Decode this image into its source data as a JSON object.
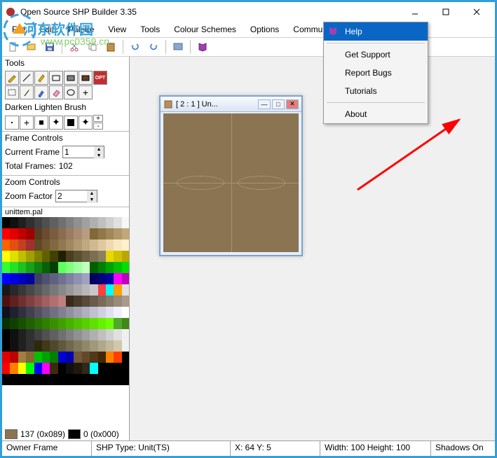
{
  "window": {
    "title": "Open Source SHP Builder 3.35"
  },
  "menubar": [
    "File",
    "Edit",
    "Palette",
    "View",
    "Tools",
    "Colour Schemes",
    "Options",
    "Community",
    "Help"
  ],
  "helpmenu": {
    "help": "Help",
    "support": "Get Support",
    "bugs": "Report Bugs",
    "tutorials": "Tutorials",
    "about": "About"
  },
  "sidebar": {
    "tools_label": "Tools",
    "dlb_label": "Darken Lighten Brush",
    "fc_label": "Frame Controls",
    "current_frame_label": "Current Frame",
    "current_frame_value": "1",
    "total_frames_label": "Total Frames:",
    "total_frames_value": "102",
    "zoom_label": "Zoom Controls",
    "zoom_factor_label": "Zoom Factor",
    "zoom_factor_value": "2",
    "palette_name": "unittem.pal",
    "swatch1_val": "137 (0x089)",
    "swatch2_val": "0 (0x000)"
  },
  "innerwin": {
    "title": "[ 2 : 1 ] Un..."
  },
  "status": {
    "s1": "Owner Frame",
    "s2": "SHP Type: Unit(TS)",
    "s3": "X: 64 Y: 5",
    "s4": "Width: 100 Height: 100",
    "s5": "Shadows On"
  },
  "watermark": {
    "line1": "河东软件园",
    "line2": "www.pc0359.cn"
  },
  "palette": [
    "#000000",
    "#101010",
    "#202020",
    "#303030",
    "#404040",
    "#505050",
    "#606060",
    "#707070",
    "#808080",
    "#909090",
    "#a0a0a0",
    "#b0b0b0",
    "#c0c0c0",
    "#d0d0d0",
    "#e0e0e0",
    "#f8f8f8",
    "#ff0000",
    "#e00000",
    "#c00000",
    "#a00000",
    "#5a3c20",
    "#6a4c30",
    "#7a5c40",
    "#8a6c50",
    "#9a7c60",
    "#a88c70",
    "#b89c80",
    "#806838",
    "#907848",
    "#a08858",
    "#b09868",
    "#c0a878",
    "#ff6000",
    "#e05010",
    "#c04020",
    "#a03030",
    "#604820",
    "#705830",
    "#806840",
    "#907850",
    "#a08860",
    "#b09870",
    "#c0a880",
    "#d0b890",
    "#e0c8a0",
    "#f0d8b0",
    "#f8e8c0",
    "#fff0d0",
    "#ffff00",
    "#e0e000",
    "#c0c000",
    "#a0a000",
    "#808000",
    "#606000",
    "#404000",
    "#202000",
    "#4a4020",
    "#5a5030",
    "#6a6040",
    "#7a7050",
    "#8a8060",
    "#e8d800",
    "#d0c000",
    "#b8a800",
    "#30ff30",
    "#28e028",
    "#20c020",
    "#18a018",
    "#108010",
    "#086008",
    "#004000",
    "#60ff60",
    "#80ff80",
    "#a0ffa0",
    "#c0ffc0",
    "#006000",
    "#008000",
    "#00a000",
    "#00c000",
    "#00e000",
    "#0000ff",
    "#0000e0",
    "#0000c0",
    "#0000a0",
    "#404060",
    "#505070",
    "#606080",
    "#707090",
    "#8080a0",
    "#9090b0",
    "#a0a0c0",
    "#000060",
    "#000080",
    "#0000a0",
    "#ff00ff",
    "#c000c0",
    "#181818",
    "#282828",
    "#383838",
    "#484848",
    "#585858",
    "#686868",
    "#787878",
    "#888888",
    "#989898",
    "#a8a8a8",
    "#b8b8b8",
    "#c8c8c8",
    "#ff4040",
    "#00ffff",
    "#ffa000",
    "#e0e0e0",
    "#501010",
    "#602020",
    "#703030",
    "#804040",
    "#905050",
    "#a06060",
    "#b07070",
    "#c08080",
    "#3a2a1a",
    "#4a3a2a",
    "#5a4a3a",
    "#6a5a4a",
    "#7a6a5a",
    "#8a7a6a",
    "#9a8a7a",
    "#aa9a8a",
    "#101020",
    "#202030",
    "#303040",
    "#404050",
    "#505060",
    "#606070",
    "#707080",
    "#808090",
    "#9090a0",
    "#a0a0b0",
    "#b0b0c0",
    "#c0c0d0",
    "#d0d0e0",
    "#e0e0f0",
    "#f0f0ff",
    "#ffffff",
    "#083000",
    "#104000",
    "#185000",
    "#206000",
    "#287000",
    "#308000",
    "#389000",
    "#40a000",
    "#48b000",
    "#50c000",
    "#58d000",
    "#60e000",
    "#68f000",
    "#70ff00",
    "#50a828",
    "#408818",
    "#000000",
    "#101010",
    "#202020",
    "#303030",
    "#404040",
    "#505050",
    "#606060",
    "#707070",
    "#808080",
    "#909090",
    "#a0a0a0",
    "#b0b0b0",
    "#c0c0c0",
    "#d0d0d0",
    "#e0e0e0",
    "#f0f0f0",
    "#000000",
    "#101010",
    "#202020",
    "#303030",
    "#30280a",
    "#40381a",
    "#50482a",
    "#60583a",
    "#70684a",
    "#80785a",
    "#90886a",
    "#a0987a",
    "#b0a88a",
    "#c0b89a",
    "#d0c8aa",
    "#f0f0f0",
    "#e00000",
    "#c00000",
    "#a08040",
    "#886830",
    "#00c000",
    "#00a000",
    "#008000",
    "#0000d0",
    "#0000b0",
    "#705838",
    "#604828",
    "#503818",
    "#402808",
    "#ff8000",
    "#ff4000",
    "#000000",
    "#ff0000",
    "#ff8000",
    "#ffff00",
    "#00ff00",
    "#0000ff",
    "#ff00ff",
    "#402810",
    "#000000",
    "#101010",
    "#201808",
    "#302818",
    "#00ffff",
    "#000000",
    "#000000",
    "#000000",
    "#000000",
    "#000000",
    "#000000",
    "#000000",
    "#000000",
    "#000000",
    "#000000",
    "#000000",
    "#000000",
    "#000000",
    "#000000",
    "#000000",
    "#000000",
    "#000000",
    "#000000",
    "#000000",
    "#000000"
  ]
}
